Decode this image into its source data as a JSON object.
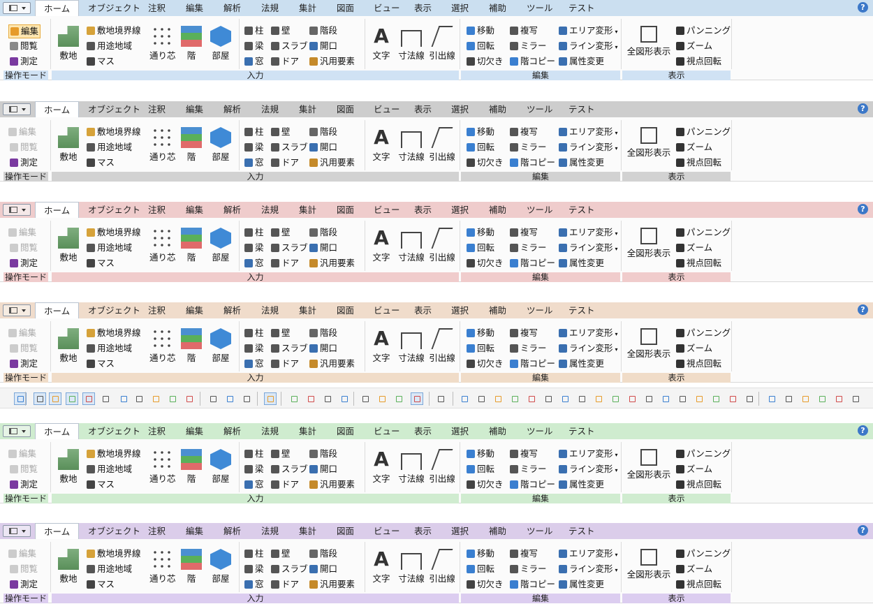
{
  "ribbons": [
    {
      "bar": "#cbdff0",
      "app": "#f6f8fb",
      "glab": "#d0e2f4",
      "disabled": false
    },
    {
      "bar": "#cdcdcd",
      "app": "#eeeeee",
      "glab": "#d2d2d2",
      "disabled": true
    },
    {
      "bar": "#efcccc",
      "app": "#f5e8e8",
      "glab": "#f0cccc",
      "disabled": true
    },
    {
      "bar": "#f0dccb",
      "app": "#f6ece2",
      "glab": "#f0dcc8",
      "disabled": true
    },
    {
      "bar": "#cfeccf",
      "app": "#e6f4e6",
      "glab": "#d0ecd0",
      "disabled": true
    },
    {
      "bar": "#dbcdea",
      "app": "#ece6f4",
      "glab": "#dccdf0",
      "disabled": true
    }
  ],
  "tabs": [
    "ホーム",
    "オブジェクト",
    "注釈",
    "編集",
    "解析",
    "法規",
    "集計",
    "図面",
    "ビュー",
    "表示",
    "選択",
    "補助",
    "ツール",
    "テスト"
  ],
  "help_label": "?",
  "mode": {
    "edit": "編集",
    "view": "閲覧",
    "measure": "測定",
    "group": "操作モード"
  },
  "input": {
    "site": "敷地",
    "boundary": "敷地境界線",
    "zone": "用途地域",
    "mass": "マス",
    "grid": "通り芯",
    "floor": "階",
    "room": "部屋",
    "column": "柱",
    "wall": "壁",
    "stair": "階段",
    "beam": "梁",
    "slab": "スラブ",
    "opening": "開口",
    "window": "窓",
    "door": "ドア",
    "generic": "汎用要素",
    "text": "文字",
    "dim": "寸法線",
    "leader": "引出線",
    "group": "入力"
  },
  "edit": {
    "move": "移動",
    "copy": "複写",
    "area": "エリア変形",
    "rotate": "回転",
    "mirror": "ミラー",
    "line": "ライン変形",
    "cut": "切欠き",
    "floorcopy": "階コピー",
    "attr": "属性変更",
    "group": "編集"
  },
  "display": {
    "fit": "全図形表示",
    "pan": "パンニング",
    "zoom": "ズーム",
    "orbit": "視点回転",
    "group": "表示"
  },
  "colors": {
    "accent": "#3c78c8",
    "selected": "#fde7b2"
  }
}
